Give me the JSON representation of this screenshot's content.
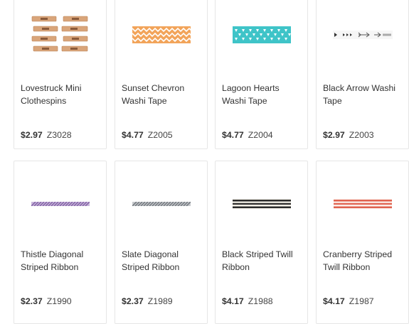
{
  "products": [
    {
      "name": "Lovestruck Mini Clothespins",
      "price": "$2.97",
      "sku": "Z3028",
      "image_icon": "clothespins-image"
    },
    {
      "name": "Sunset Chevron Washi Tape",
      "price": "$4.77",
      "sku": "Z2005",
      "image_icon": "chevron-tape-image",
      "color": "#f2a45a"
    },
    {
      "name": "Lagoon Hearts Washi Tape",
      "price": "$4.77",
      "sku": "Z2004",
      "image_icon": "hearts-tape-image",
      "color": "#3fc4c8"
    },
    {
      "name": "Black Arrow Washi Tape",
      "price": "$2.97",
      "sku": "Z2003",
      "image_icon": "arrow-tape-image",
      "color": "#444444"
    },
    {
      "name": "Thistle Diagonal Striped Ribbon",
      "price": "$2.37",
      "sku": "Z1990",
      "image_icon": "thistle-ribbon-image",
      "color": "#9a7ab8"
    },
    {
      "name": "Slate Diagonal Striped Ribbon",
      "price": "$2.37",
      "sku": "Z1989",
      "image_icon": "slate-ribbon-image",
      "color": "#8a8f94"
    },
    {
      "name": "Black Striped Twill Ribbon",
      "price": "$4.17",
      "sku": "Z1988",
      "image_icon": "black-twill-image",
      "color": "#2b2b2b"
    },
    {
      "name": "Cranberry Striped Twill Ribbon",
      "price": "$4.17",
      "sku": "Z1987",
      "image_icon": "cranberry-twill-image",
      "color": "#e0624f"
    }
  ]
}
